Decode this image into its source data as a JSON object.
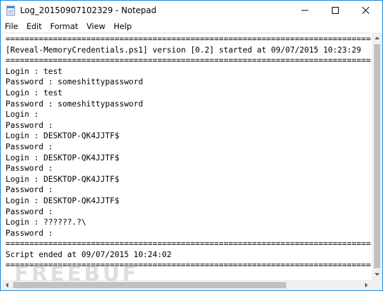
{
  "window": {
    "title": "Log_20150907102329 - Notepad",
    "accent_color": "#1883d7",
    "app_icon": "notepad-icon"
  },
  "caption_buttons": {
    "minimize_icon": "minimize-icon",
    "maximize_icon": "maximize-icon",
    "close_icon": "close-icon"
  },
  "menu": {
    "items": [
      "File",
      "Edit",
      "Format",
      "View",
      "Help"
    ]
  },
  "editor": {
    "lines": [
      "================================================================================",
      "[Reveal-MemoryCredentials.ps1] version [0.2] started at 09/07/2015 10:23:29",
      "================================================================================",
      "Login : test",
      "Password : someshittypassword",
      "Login : test",
      "Password : someshittypassword",
      "Login :",
      "Password :",
      "Login : DESKTOP-QK4JJTF$",
      "Password :",
      "Login : DESKTOP-QK4JJTF$",
      "Password :",
      "Login : DESKTOP-QK4JJTF$",
      "Password :",
      "Login : DESKTOP-QK4JJTF$",
      "Password :",
      "Login : ??????.?\\",
      "Password :",
      "================================================================================",
      "Script ended at 09/07/2015 10:24:02",
      "================================================================================"
    ]
  },
  "watermark": "FREEBUF"
}
